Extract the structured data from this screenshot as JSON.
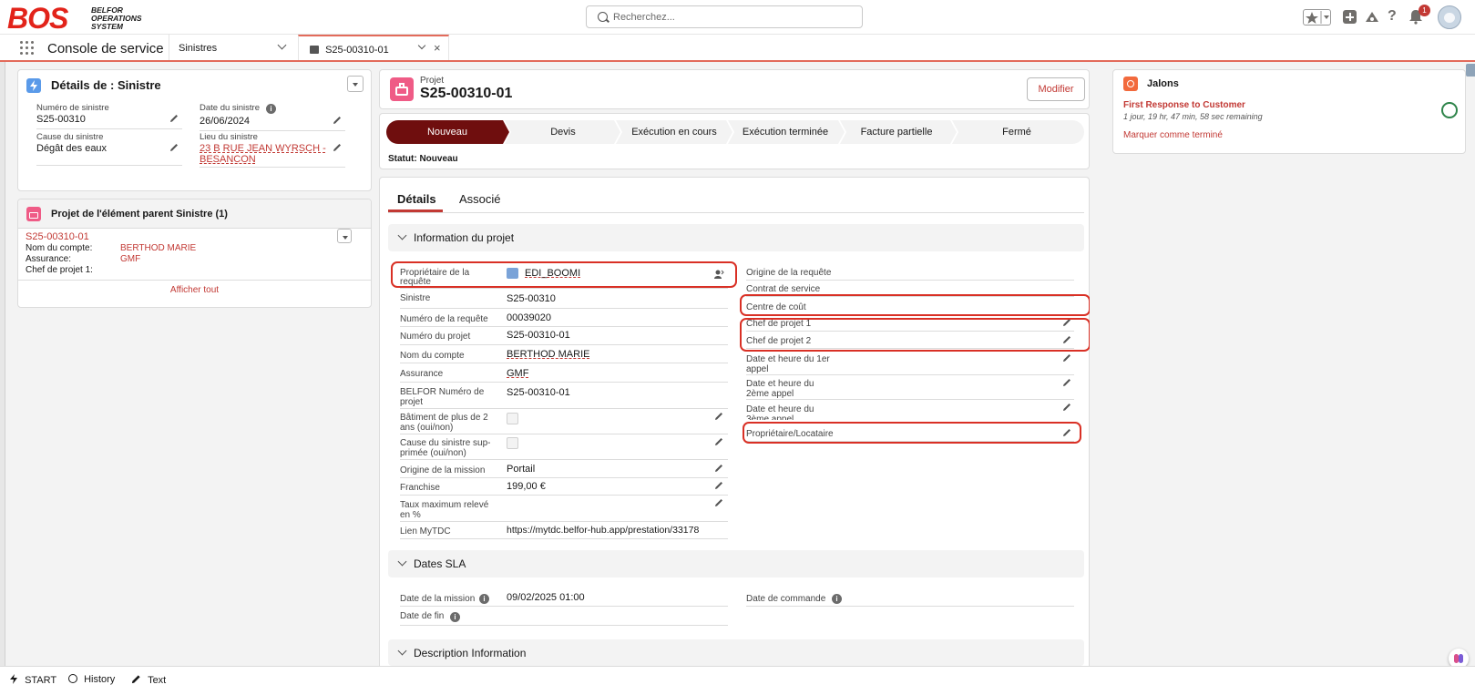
{
  "header": {
    "logo_mark": "BOS",
    "logo_line1": "BELFOR",
    "logo_line2": "OPERATIONS",
    "logo_line3": "SYSTEM",
    "search_placeholder": "Recherchez...",
    "notification_count": "1"
  },
  "nav": {
    "app_name": "Console de service",
    "tab1": "Sinistres",
    "tab2": "S25-00310-01"
  },
  "sinistre_card": {
    "title": "Détails de : Sinistre",
    "numero_label": "Numéro de sinistre",
    "numero_value": "S25-00310",
    "date_label": "Date du sinistre",
    "date_value": "26/06/2024",
    "cause_label": "Cause du sinistre",
    "cause_value": "Dégât des eaux",
    "lieu_label": "Lieu du sinistre",
    "lieu_line1": "23 B RUE JEAN WYRSCH -",
    "lieu_line2": "BESANCON"
  },
  "parent_card": {
    "title": "Projet de l'élément parent Sinistre (1)",
    "record": "S25-00310-01",
    "compte_label": "Nom du compte:",
    "compte_value": "BERTHOD MARIE",
    "assurance_label": "Assurance:",
    "assurance_value": "GMF",
    "chef_label": "Chef de projet 1:",
    "view_all": "Afficher tout"
  },
  "project": {
    "object": "Projet",
    "name": "S25-00310-01",
    "edit": "Modifier",
    "path": [
      "Nouveau",
      "Devis",
      "Exécution en cours",
      "Exécution terminée",
      "Facture partielle",
      "Fermé"
    ],
    "status": "Statut: Nouveau"
  },
  "tabs": {
    "details": "Détails",
    "related": "Associé"
  },
  "section_info": "Information du projet",
  "left_fields": {
    "owner_l1": "Propriétaire de la",
    "owner_l2": "requête",
    "owner_v": "EDI_BOOMI",
    "sinistre_l": "Sinistre",
    "sinistre_v": "S25-00310",
    "req_l": "Numéro de la requête",
    "req_v": "00039020",
    "proj_l": "Numéro du projet",
    "proj_v": "S25-00310-01",
    "compte_l": "Nom du compte",
    "compte_v": "BERTHOD MARIE",
    "assur_l": "Assurance",
    "assur_v": "GMF",
    "belfor_l1": "BELFOR Numéro de",
    "belfor_l2": "projet",
    "belfor_v": "S25-00310-01",
    "bat_l1": "Bâtiment de plus de 2",
    "bat_l2": "ans (oui/non)",
    "cause_l1": "Cause du sinistre sup-",
    "cause_l2": "primée (oui/non)",
    "origine_l": "Origine de la mission",
    "origine_v": "Portail",
    "franchise_l": "Franchise",
    "franchise_v": "199,00 €",
    "taux_l1": "Taux maximum relevé",
    "taux_l2": "en %",
    "mytdc_l": "Lien MyTDC",
    "mytdc_v": "https://mytdc.belfor-hub.app/prestation/33178"
  },
  "right_fields": {
    "origine_req": "Origine de la requête",
    "contrat": "Contrat de service",
    "centre": "Centre de coût",
    "chef1": "Chef de projet 1",
    "chef2": "Chef de projet 2",
    "appel1_l1": "Date et heure du 1er",
    "appel1_l2": "appel",
    "appel2_l1": "Date et heure du",
    "appel2_l2": "2ème appel",
    "appel3_l1": "Date et heure du",
    "appel3_l2": "3ème appel",
    "prop_loc": "Propriétaire/Locataire"
  },
  "section_sla": "Dates SLA",
  "sla": {
    "mission_l": "Date de la mission",
    "mission_v": "09/02/2025 01:00",
    "commande_l": "Date de commande",
    "fin_l": "Date de fin"
  },
  "section_desc": "Description Information",
  "jalons": {
    "title": "Jalons",
    "milestone": "First Response to Customer",
    "remaining": "1 jour, 19 hr, 47 min, 58 sec remaining",
    "action": "Marquer comme terminé"
  },
  "bottom": {
    "start": "START",
    "history": "History",
    "text": "Text"
  },
  "colors": {
    "brand_red": "#e2231a",
    "path_active": "#6f0e0e",
    "link": "#c23934",
    "highlight": "#d93025"
  }
}
